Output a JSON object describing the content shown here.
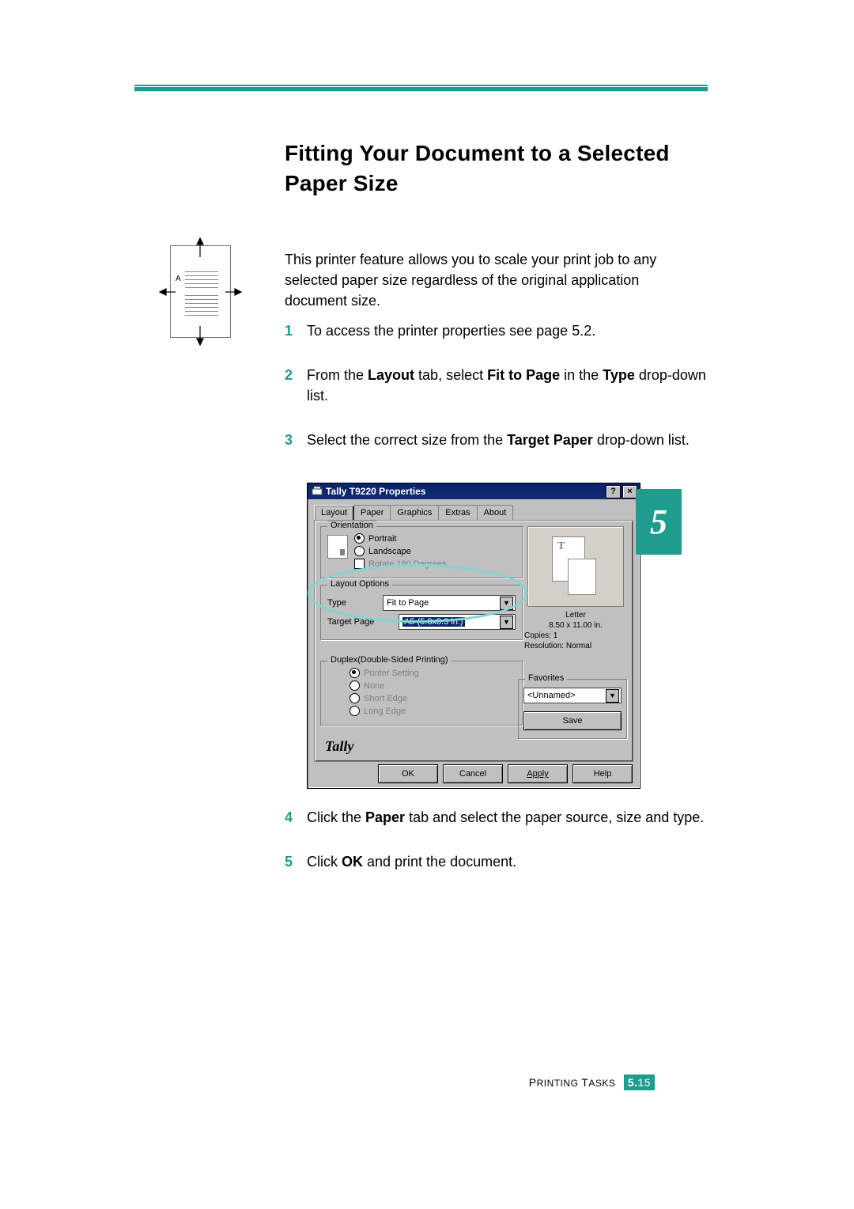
{
  "heading": "Fitting Your Document to a Selected Paper Size",
  "intro": "This printer feature allows you to scale your print job to any selected paper size regardless of the original application document size.",
  "side_diagram_label": "A",
  "steps": {
    "s1_num": "1",
    "s1_text": "To access the printer properties see page 5.2.",
    "s2_num": "2",
    "s2_pre": "From the ",
    "s2_b1": "Layout",
    "s2_mid1": " tab, select ",
    "s2_b2": "Fit to Page",
    "s2_mid2": " in the ",
    "s2_b3": "Type",
    "s2_post": " drop-down list.",
    "s3_num": "3",
    "s3_pre": "Select the correct size from the ",
    "s3_b1": "Target Paper",
    "s3_post": " drop-down list.",
    "s4_num": "4",
    "s4_pre": "Click the ",
    "s4_b1": "Paper",
    "s4_post": " tab and select the paper source, size and type.",
    "s5_num": "5",
    "s5_pre": "Click ",
    "s5_b1": "OK",
    "s5_post": " and print the document."
  },
  "chapter_tab": "5",
  "dialog": {
    "title": "Tally T9220 Properties",
    "help_btn": "?",
    "close_btn": "×",
    "tabs": {
      "layout": "Layout",
      "paper": "Paper",
      "graphics": "Graphics",
      "extras": "Extras",
      "about": "About"
    },
    "orientation": {
      "legend": "Orientation",
      "portrait": "Portrait",
      "landscape": "Landscape",
      "rotate": "Rotate 180 Degrees"
    },
    "layout_options": {
      "legend": "Layout Options",
      "type_label": "Type",
      "type_value": "Fit to Page",
      "target_label": "Target Page",
      "target_value": "A5 (5.8x8.3 in.)"
    },
    "preview": {
      "paper_name": "Letter",
      "paper_dim": "8.50 x 11.00 in.",
      "copies_label": "Copies:",
      "copies_value": "1",
      "res_label": "Resolution:",
      "res_value": "Normal"
    },
    "duplex": {
      "legend": "Duplex(Double-Sided Printing)",
      "printer_setting": "Printer Setting",
      "none": "None",
      "short_edge": "Short Edge",
      "long_edge": "Long Edge"
    },
    "favorites": {
      "legend": "Favorites",
      "value": "<Unnamed>",
      "save": "Save"
    },
    "brand": "Tally",
    "buttons": {
      "ok": "OK",
      "cancel": "Cancel",
      "apply": "Apply",
      "help": "Help"
    }
  },
  "footer": {
    "section_pre": "P",
    "section_rest": "RINTING ",
    "section_pre2": "T",
    "section_rest2": "ASKS",
    "page_major": "5",
    "page_dot": ".",
    "page_minor": "15"
  }
}
